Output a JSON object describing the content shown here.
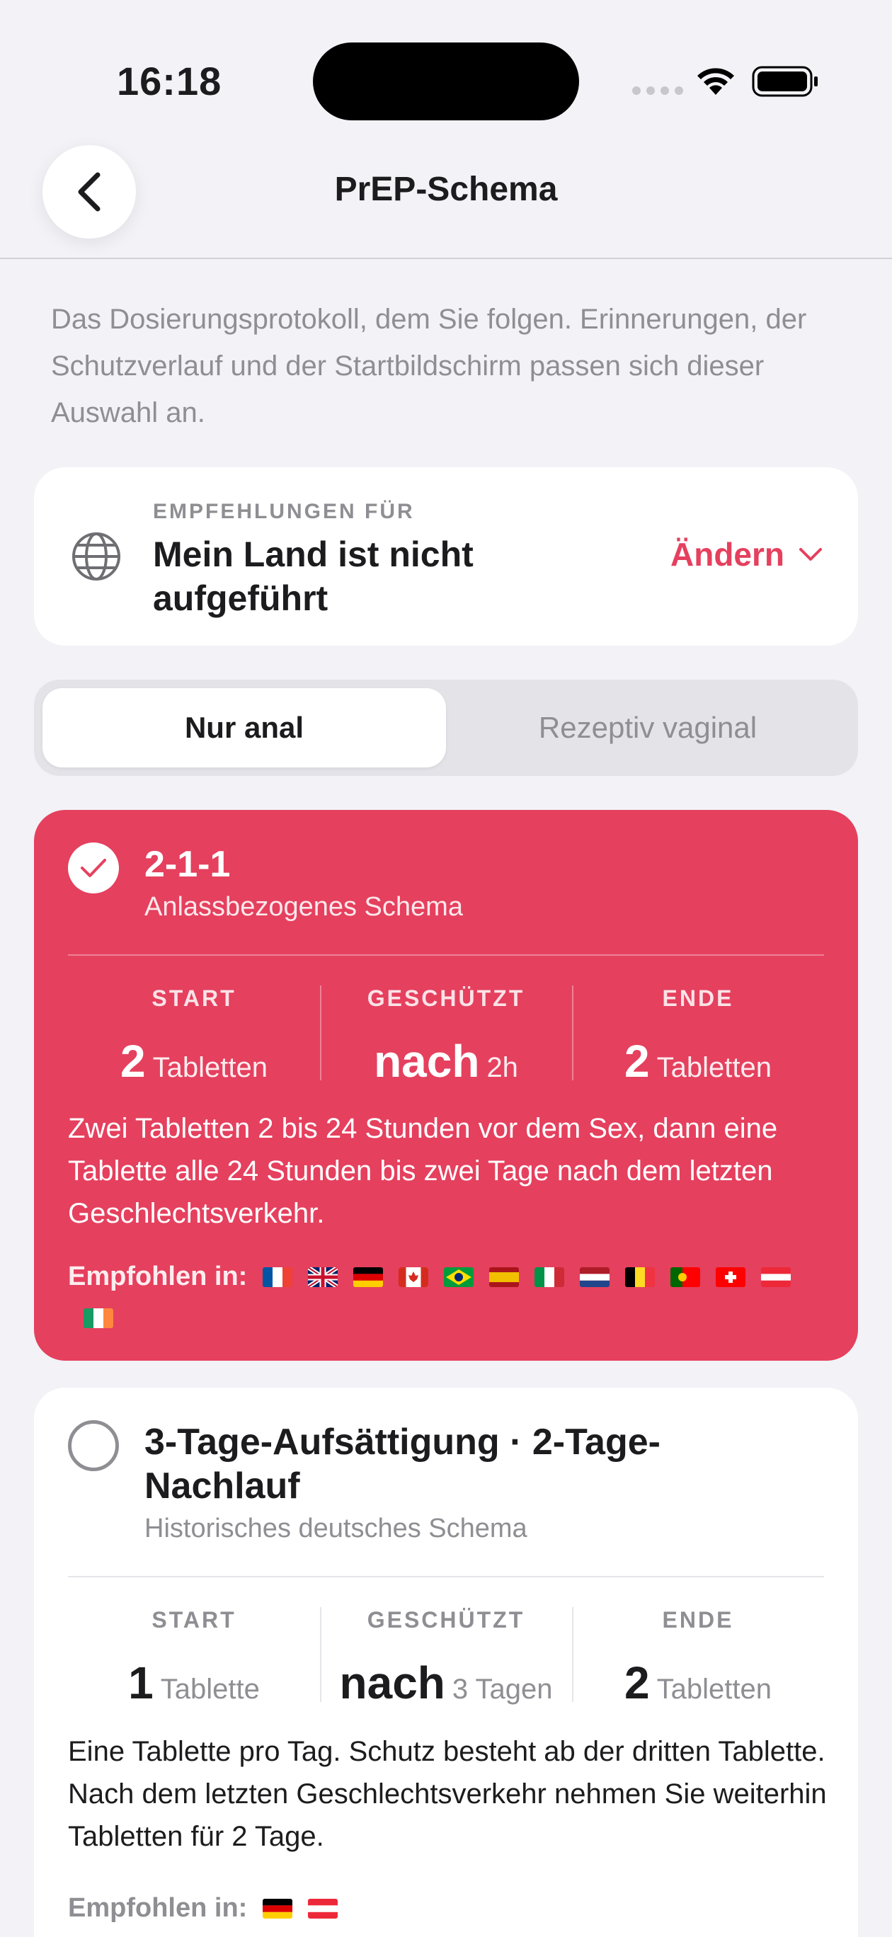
{
  "status_bar": {
    "time": "16:18"
  },
  "nav": {
    "title": "PrEP-Schema"
  },
  "intro": "Das Dosierungsprotokoll, dem Sie folgen. Erinnerungen, der Schutzverlauf und der Startbildschirm passen sich dieser Auswahl an.",
  "country": {
    "eyebrow": "EMPFEHLUNGEN FÜR",
    "name": "Mein Land ist nicht aufgeführt",
    "change_label": "Ändern"
  },
  "segments": [
    {
      "label": "Nur anal",
      "selected": true
    },
    {
      "label": "Rezeptiv vaginal",
      "selected": false
    }
  ],
  "schemes": [
    {
      "title": "2-1-1",
      "subtitle": "Anlassbezogenes Schema",
      "selected": true,
      "stats": [
        {
          "label": "START",
          "value": "2",
          "unit": "Tabletten"
        },
        {
          "label": "GESCHÜTZT",
          "value": "nach",
          "unit": "2h"
        },
        {
          "label": "ENDE",
          "value": "2",
          "unit": "Tabletten"
        }
      ],
      "description": "Zwei Tabletten 2 bis 24 Stunden vor dem Sex, dann eine Tablette alle 24 Stunden bis zwei Tage nach dem letzten Geschlechtsverkehr.",
      "recommended_label": "Empfohlen in:",
      "flags": [
        "france",
        "united-kingdom",
        "germany",
        "canada",
        "brazil",
        "spain",
        "italy",
        "netherlands",
        "belgium",
        "portugal",
        "switzerland",
        "austria",
        "ireland"
      ]
    },
    {
      "title": "3-Tage-Aufsättigung · 2-Tage-Nachlauf",
      "subtitle": "Historisches deutsches Schema",
      "selected": false,
      "stats": [
        {
          "label": "START",
          "value": "1",
          "unit": "Tablette"
        },
        {
          "label": "GESCHÜTZT",
          "value": "nach",
          "unit": "3 Tagen"
        },
        {
          "label": "ENDE",
          "value": "2",
          "unit": "Tabletten"
        }
      ],
      "description": "Eine Tablette pro Tag. Schutz besteht ab der dritten Tablette. Nach dem letzten Geschlechtsverkehr nehmen Sie weiterhin Tabletten für 2 Tage.",
      "recommended_label": "Empfohlen in:",
      "flags": [
        "germany",
        "austria"
      ]
    }
  ],
  "colors": {
    "accent": "#e5405e",
    "background": "#f2f2f7",
    "secondary_text": "#8e8e93"
  }
}
